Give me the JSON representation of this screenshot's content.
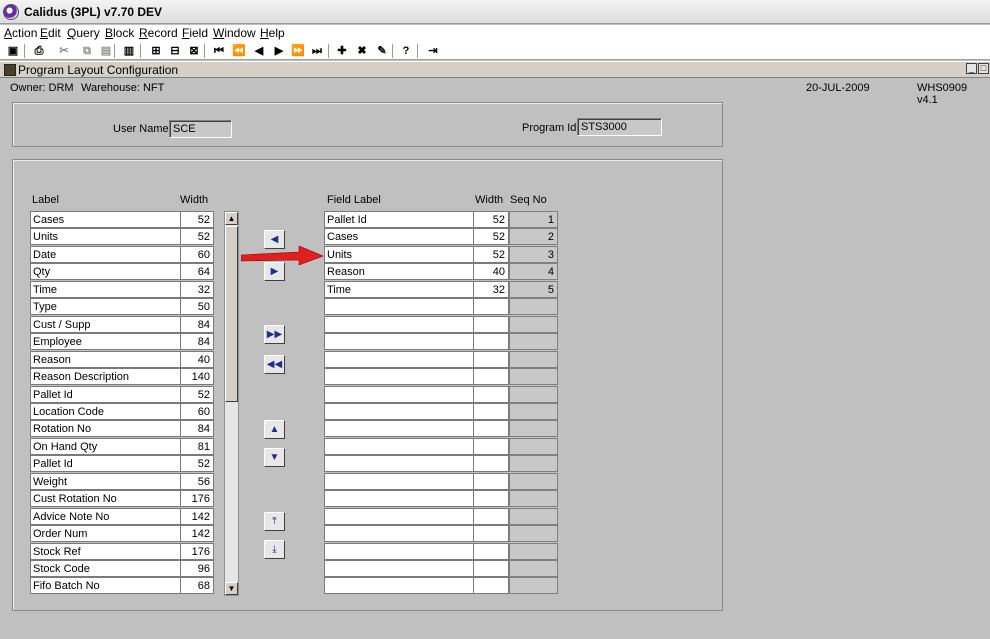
{
  "app": {
    "title": "Calidus (3PL) v7.70 DEV"
  },
  "menu": [
    "Action",
    "Edit",
    "Query",
    "Block",
    "Record",
    "Field",
    "Window",
    "Help"
  ],
  "toolbar": [
    {
      "name": "save-icon",
      "glyph": "▣"
    },
    {
      "name": "print-icon",
      "glyph": "⎙"
    },
    {
      "name": "cut-icon",
      "glyph": "✂",
      "dim": true
    },
    {
      "name": "copy-icon",
      "glyph": "⧉",
      "dim": true
    },
    {
      "name": "paste-icon",
      "glyph": "▤",
      "dim": true
    },
    {
      "name": "clear-icon",
      "glyph": "▥"
    },
    {
      "name": "find-icon",
      "glyph": "⊞"
    },
    {
      "name": "find-all-icon",
      "glyph": "⊟"
    },
    {
      "name": "query-icon",
      "glyph": "⊠"
    },
    {
      "name": "first-record-icon",
      "glyph": "⏮"
    },
    {
      "name": "prev-block-icon",
      "glyph": "⏪"
    },
    {
      "name": "prev-record-icon",
      "glyph": "◀"
    },
    {
      "name": "next-record-icon",
      "glyph": "▶"
    },
    {
      "name": "next-block-icon",
      "glyph": "⏩"
    },
    {
      "name": "last-record-icon",
      "glyph": "⏭"
    },
    {
      "name": "insert-record-icon",
      "glyph": "✚"
    },
    {
      "name": "delete-record-icon",
      "glyph": "✖"
    },
    {
      "name": "edit-icon",
      "glyph": "✎"
    },
    {
      "name": "help-icon",
      "glyph": "?"
    },
    {
      "name": "exit-icon",
      "glyph": "⇥"
    }
  ],
  "window": {
    "title": "Program Layout Configuration"
  },
  "info": {
    "owner": "Owner:  DRM",
    "warehouse": "Warehouse:  NFT",
    "date": "20-JUL-2009",
    "form": "WHS0909  v4.1"
  },
  "user": {
    "label": "User Name:",
    "value": "SCE"
  },
  "program": {
    "label": "Program Id:",
    "value": "STS3000"
  },
  "available": {
    "label_header": "Label",
    "width_header": "Width",
    "rows": [
      {
        "label": "Cases",
        "width": "52"
      },
      {
        "label": "Units",
        "width": "52"
      },
      {
        "label": "Date",
        "width": "60"
      },
      {
        "label": "Qty",
        "width": "64"
      },
      {
        "label": "Time",
        "width": "32"
      },
      {
        "label": "Type",
        "width": "50"
      },
      {
        "label": "Cust / Supp",
        "width": "84"
      },
      {
        "label": "Employee",
        "width": "84"
      },
      {
        "label": "Reason",
        "width": "40"
      },
      {
        "label": "Reason Description",
        "width": "140"
      },
      {
        "label": "Pallet Id",
        "width": "52"
      },
      {
        "label": "Location Code",
        "width": "60"
      },
      {
        "label": "Rotation No",
        "width": "84"
      },
      {
        "label": "On Hand Qty",
        "width": "81"
      },
      {
        "label": "Pallet Id",
        "width": "52"
      },
      {
        "label": "Weight",
        "width": "56"
      },
      {
        "label": "Cust Rotation No",
        "width": "176"
      },
      {
        "label": "Advice Note No",
        "width": "142"
      },
      {
        "label": "Order Num",
        "width": "142"
      },
      {
        "label": "Stock Ref",
        "width": "176"
      },
      {
        "label": "Stock Code",
        "width": "96"
      },
      {
        "label": "Fifo Batch No",
        "width": "68"
      }
    ]
  },
  "selected": {
    "label_header": "Field Label",
    "width_header": "Width",
    "seq_header": "Seq No",
    "rows": [
      {
        "label": "Pallet Id",
        "width": "52",
        "seq": "1"
      },
      {
        "label": "Cases",
        "width": "52",
        "seq": "2"
      },
      {
        "label": "Units",
        "width": "52",
        "seq": "3"
      },
      {
        "label": "Reason",
        "width": "40",
        "seq": "4"
      },
      {
        "label": "Time",
        "width": "32",
        "seq": "5"
      },
      {
        "label": "",
        "width": "",
        "seq": ""
      },
      {
        "label": "",
        "width": "",
        "seq": ""
      },
      {
        "label": "",
        "width": "",
        "seq": ""
      },
      {
        "label": "",
        "width": "",
        "seq": ""
      },
      {
        "label": "",
        "width": "",
        "seq": ""
      },
      {
        "label": "",
        "width": "",
        "seq": ""
      },
      {
        "label": "",
        "width": "",
        "seq": ""
      },
      {
        "label": "",
        "width": "",
        "seq": ""
      },
      {
        "label": "",
        "width": "",
        "seq": ""
      },
      {
        "label": "",
        "width": "",
        "seq": ""
      },
      {
        "label": "",
        "width": "",
        "seq": ""
      },
      {
        "label": "",
        "width": "",
        "seq": ""
      },
      {
        "label": "",
        "width": "",
        "seq": ""
      },
      {
        "label": "",
        "width": "",
        "seq": ""
      },
      {
        "label": "",
        "width": "",
        "seq": ""
      },
      {
        "label": "",
        "width": "",
        "seq": ""
      },
      {
        "label": "",
        "width": "",
        "seq": ""
      }
    ]
  },
  "move_buttons": [
    {
      "name": "remove-field-button",
      "glyph": "◀"
    },
    {
      "name": "add-field-button",
      "glyph": "▶"
    },
    {
      "name": "add-all-fields-button",
      "glyph": "▶▶"
    },
    {
      "name": "remove-all-fields-button",
      "glyph": "◀◀"
    },
    {
      "name": "move-up-button",
      "glyph": "▲"
    },
    {
      "name": "move-down-button",
      "glyph": "▼"
    },
    {
      "name": "move-top-button",
      "glyph": "⤒"
    },
    {
      "name": "move-bottom-button",
      "glyph": "⤓"
    }
  ],
  "colors": {
    "annotation_arrow": "#e02020",
    "button_glyph": "#1f2f8f"
  }
}
